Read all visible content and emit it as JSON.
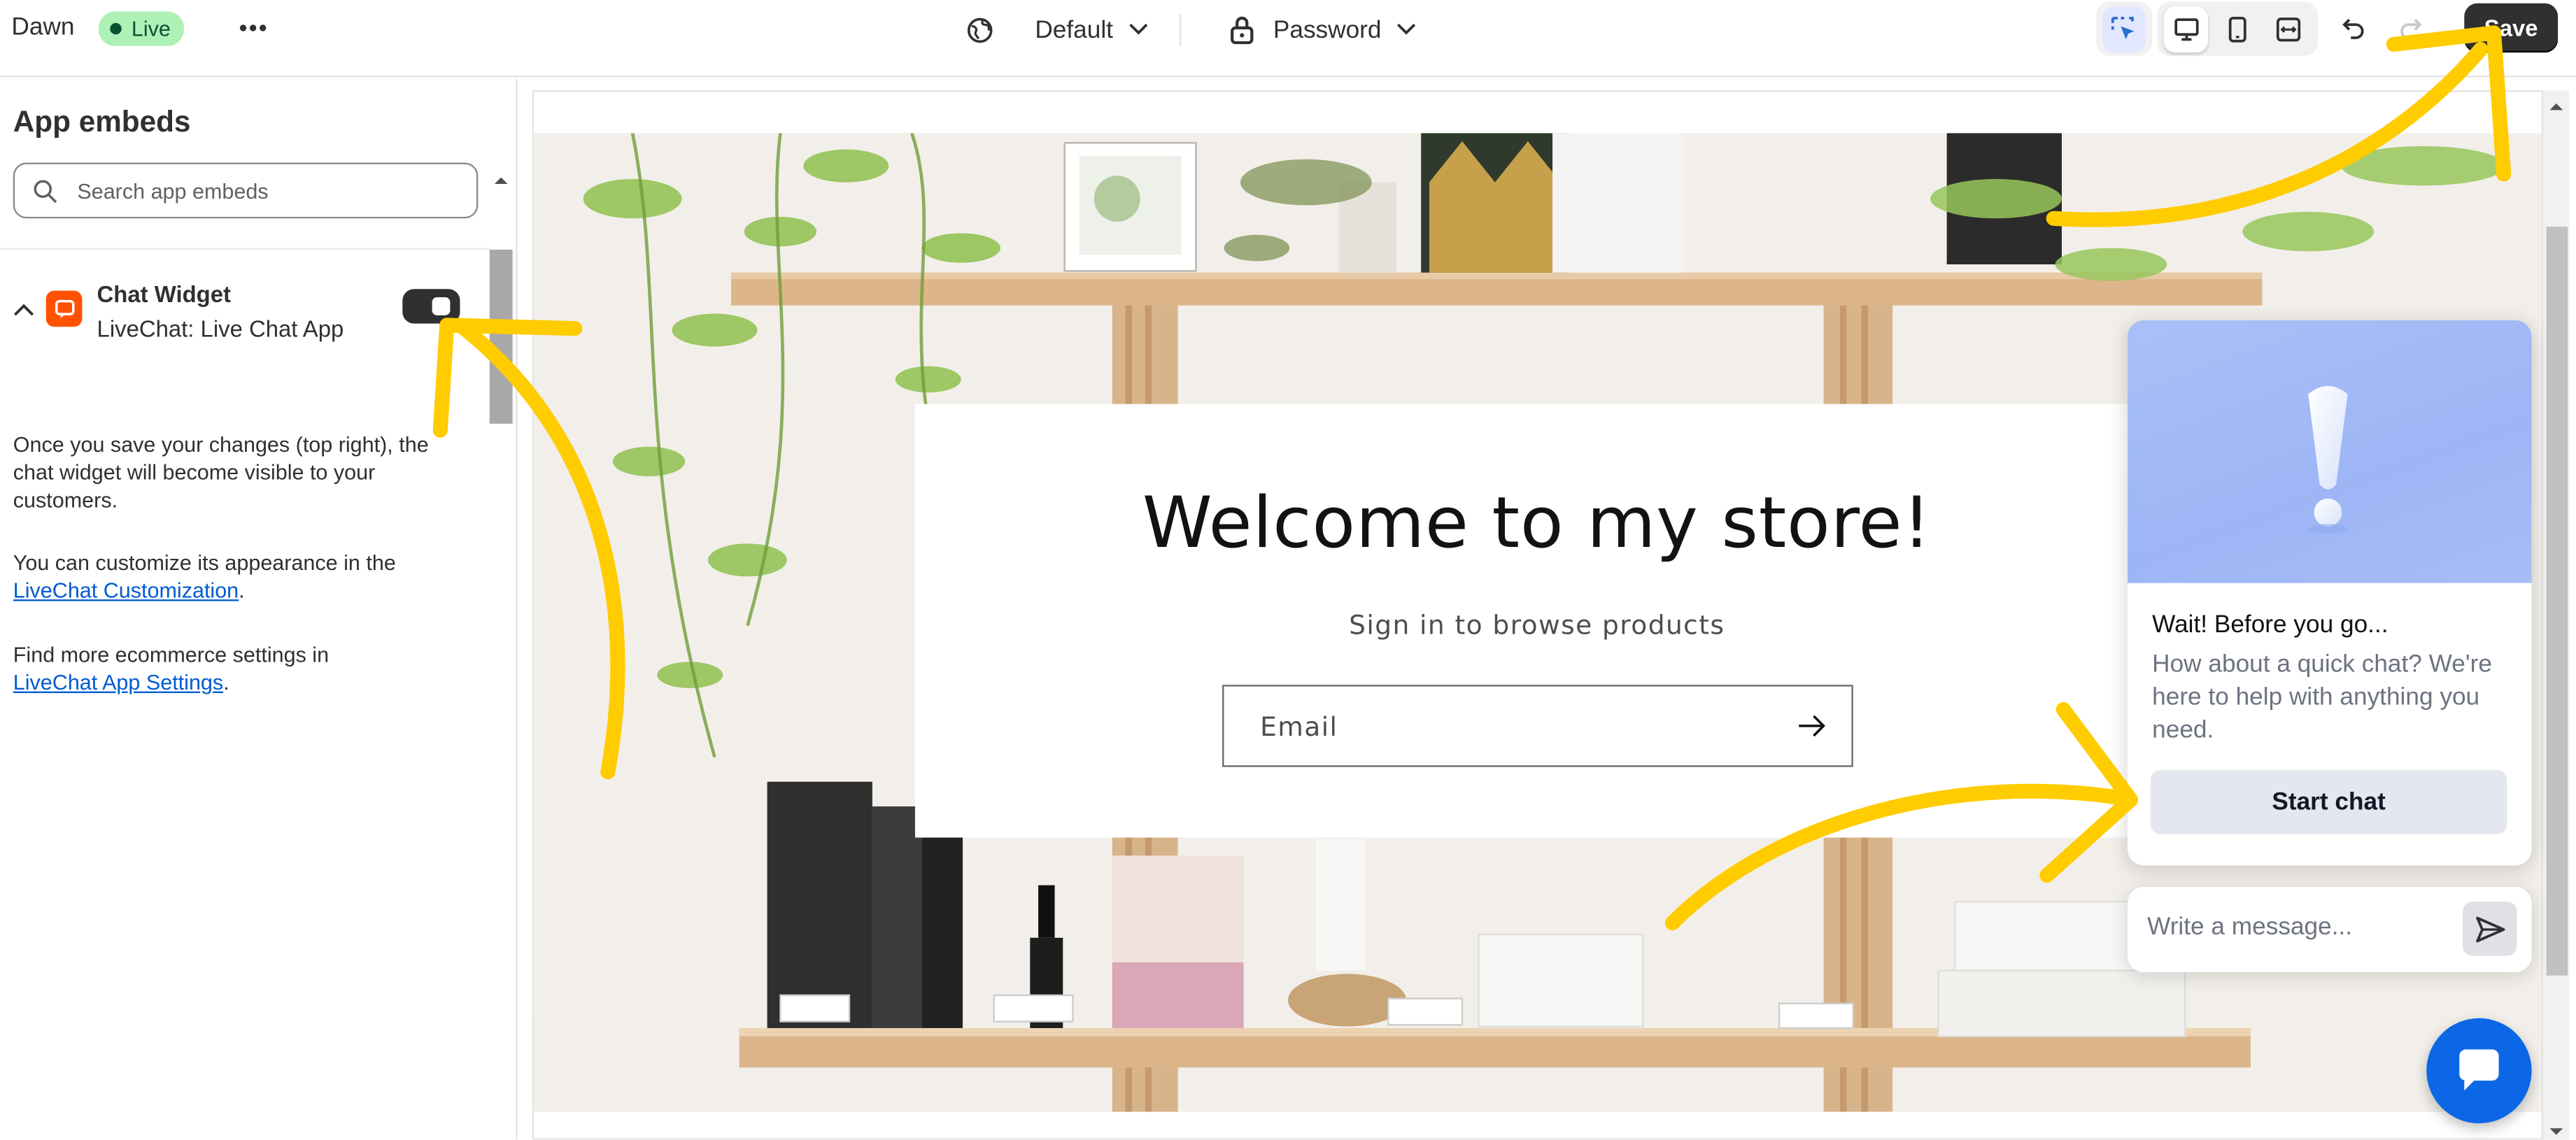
{
  "topbar": {
    "store_name": "Dawn",
    "status_badge": "Live",
    "theme": "Default",
    "page": "Password",
    "save_label": "Save"
  },
  "sidebar": {
    "title": "App embeds",
    "search_placeholder": "Search app embeds",
    "embed": {
      "name": "Chat Widget",
      "app": "LiveChat: Live Chat App",
      "enabled": true,
      "icon": "chat-bubble-icon"
    },
    "info": {
      "p1": "Once you save your changes (top right), the chat widget will become visible to your customers.",
      "p2_text": "You can customize its appearance in the",
      "p2_link": "LiveChat Customization",
      "p3_text": "Find more ecommerce settings in",
      "p3_link": "LiveChat App Settings"
    }
  },
  "store": {
    "heading": "Welcome to my store!",
    "subheading": "Sign in to browse products",
    "email_placeholder": "Email"
  },
  "chat": {
    "heading": "Wait! Before you go...",
    "body": "How about a quick chat? We're here to help with anything you need.",
    "button": "Start chat",
    "message_placeholder": "Write a message..."
  },
  "colors": {
    "accent_dark": "#303030",
    "live_badge": "#aff0b5",
    "livechat_orange": "#ff5100",
    "livechat_blue": "#0b67e6",
    "annotation_yellow": "#ffcc00",
    "link_blue": "#005bd3"
  }
}
